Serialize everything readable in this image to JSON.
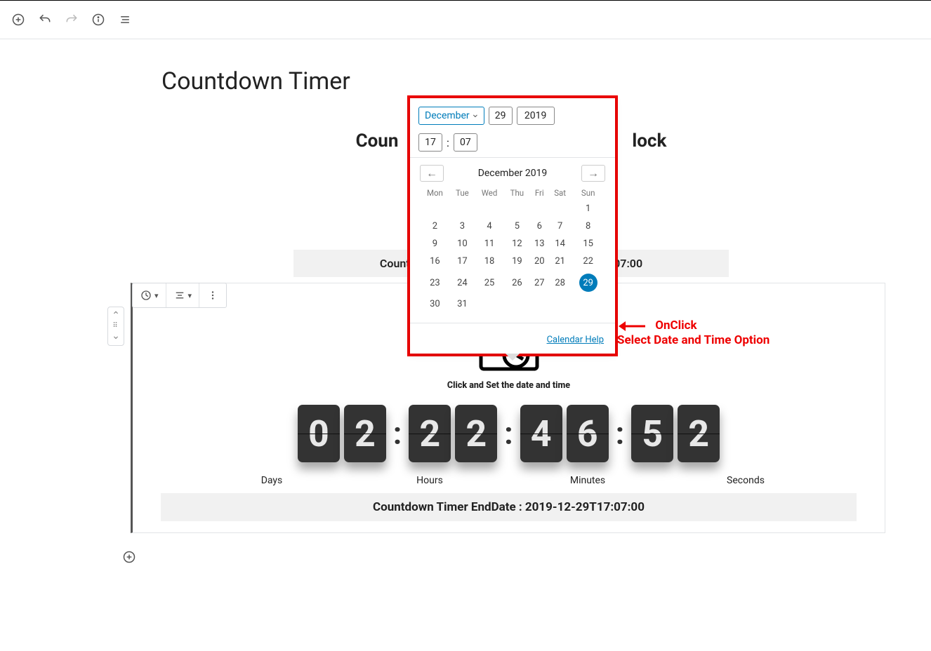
{
  "page_title": "Countdown Timer",
  "block_title_visible_prefix": "Coun",
  "block_title_visible_suffix": "lock",
  "preview_end_prefix": "Countd",
  "preview_end_suffix": "7:07:00",
  "datepicker": {
    "month": "December",
    "day": "29",
    "year": "2019",
    "hour": "17",
    "minute": "07",
    "colon": ":",
    "nav_title": "December 2019",
    "weekdays": [
      "Mon",
      "Tue",
      "Wed",
      "Thu",
      "Fri",
      "Sat",
      "Sun"
    ],
    "weeks": [
      [
        "",
        "",
        "",
        "",
        "",
        "",
        "1"
      ],
      [
        "2",
        "3",
        "4",
        "5",
        "6",
        "7",
        "8"
      ],
      [
        "9",
        "10",
        "11",
        "12",
        "13",
        "14",
        "15"
      ],
      [
        "16",
        "17",
        "18",
        "19",
        "20",
        "21",
        "22"
      ],
      [
        "23",
        "24",
        "25",
        "26",
        "27",
        "28",
        "29"
      ],
      [
        "30",
        "31",
        "",
        "",
        "",
        "",
        ""
      ]
    ],
    "selected_day": "29",
    "help_label": "Calendar Help"
  },
  "annotation": {
    "line1": "OnClick",
    "line2": "Select Date and Time Option"
  },
  "cal_subtitle": "Click and Set the date and time",
  "countdown": {
    "days": [
      "0",
      "2"
    ],
    "hours": [
      "2",
      "2"
    ],
    "minutes": [
      "4",
      "6"
    ],
    "seconds": [
      "5",
      "2"
    ],
    "labels": {
      "days": "Days",
      "hours": "Hours",
      "minutes": "Minutes",
      "seconds": "Seconds"
    }
  },
  "enddate_full": "Countdown Timer EndDate : 2019-12-29T17:07:00"
}
